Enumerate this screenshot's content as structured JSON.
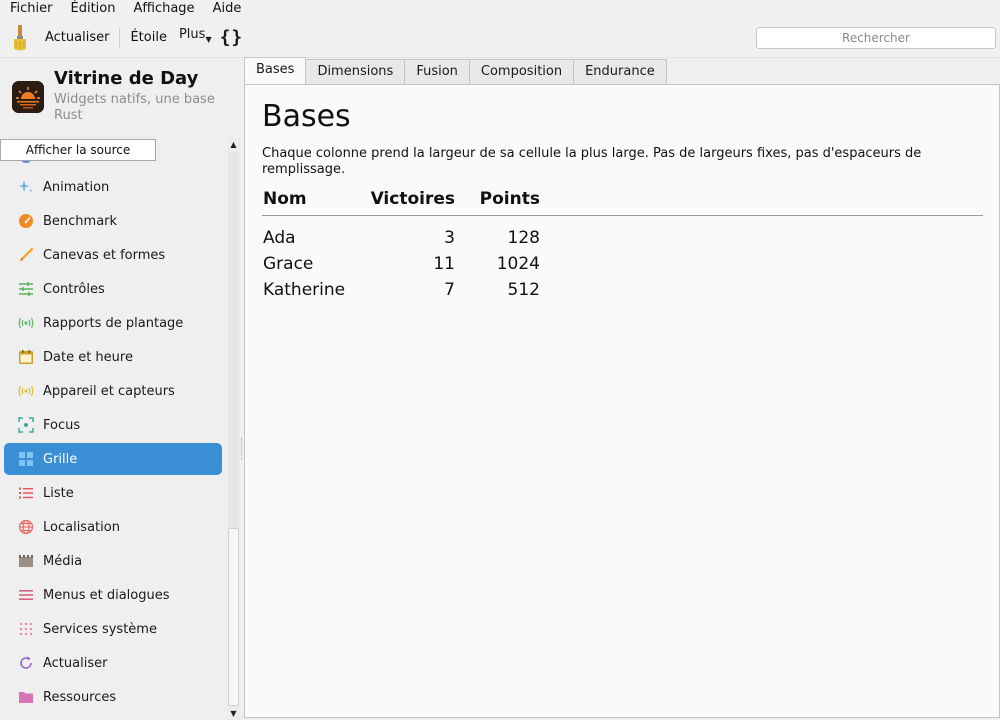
{
  "menubar": {
    "items": [
      "Fichier",
      "Édition",
      "Affichage",
      "Aide"
    ]
  },
  "toolbar": {
    "icon": "paintbrush-icon",
    "refresh_label": "Actualiser",
    "star_label": "Étoile",
    "more_label": "Plus",
    "braces_label": "{}",
    "search_placeholder": "Rechercher"
  },
  "app": {
    "title": "Vitrine de Day",
    "subtitle": "Widgets natifs, une base Rust",
    "logo_icon": "sunset-logo-icon"
  },
  "sidebar": {
    "source_button": "Afficher la source",
    "items": [
      {
        "label": "Animation",
        "icon": "sparkle-icon",
        "color": "#6aaee8"
      },
      {
        "label": "Benchmark",
        "icon": "gauge-icon",
        "color": "#f08a24"
      },
      {
        "label": "Canevas et formes",
        "icon": "brush-icon",
        "color": "#f5a623"
      },
      {
        "label": "Contrôles",
        "icon": "sliders-icon",
        "color": "#4caf50"
      },
      {
        "label": "Rapports de plantage",
        "icon": "broadcast-icon",
        "color": "#5cc26b"
      },
      {
        "label": "Date et heure",
        "icon": "calendar-icon",
        "color": "#c9a227"
      },
      {
        "label": "Appareil et capteurs",
        "icon": "sensor-icon",
        "color": "#e0c23a"
      },
      {
        "label": "Focus",
        "icon": "focus-icon",
        "color": "#3aa89a"
      },
      {
        "label": "Grille",
        "icon": "grid-icon",
        "color": "#7fc4f0",
        "active": true
      },
      {
        "label": "Liste",
        "icon": "list-icon",
        "color": "#e8505b"
      },
      {
        "label": "Localisation",
        "icon": "globe-icon",
        "color": "#e86a6a"
      },
      {
        "label": "Média",
        "icon": "film-icon",
        "color": "#9a8f85"
      },
      {
        "label": "Menus et dialogues",
        "icon": "menu-icon",
        "color": "#d9637e"
      },
      {
        "label": "Services système",
        "icon": "dots-grid-icon",
        "color": "#e88aa8"
      },
      {
        "label": "Actualiser",
        "icon": "refresh-icon",
        "color": "#9b5fc9"
      },
      {
        "label": "Ressources",
        "icon": "folder-icon",
        "color": "#d873b5"
      }
    ]
  },
  "tabs": [
    {
      "label": "Bases",
      "active": true
    },
    {
      "label": "Dimensions"
    },
    {
      "label": "Fusion"
    },
    {
      "label": "Composition"
    },
    {
      "label": "Endurance"
    }
  ],
  "panel": {
    "title": "Bases",
    "description": "Chaque colonne prend la largeur de sa cellule la plus large. Pas de largeurs fixes, pas d'espaceurs de remplissage.",
    "table": {
      "headers": [
        "Nom",
        "Victoires",
        "Points"
      ],
      "rows": [
        [
          "Ada",
          "3",
          "128"
        ],
        [
          "Grace",
          "11",
          "1024"
        ],
        [
          "Katherine",
          "7",
          "512"
        ]
      ]
    }
  }
}
